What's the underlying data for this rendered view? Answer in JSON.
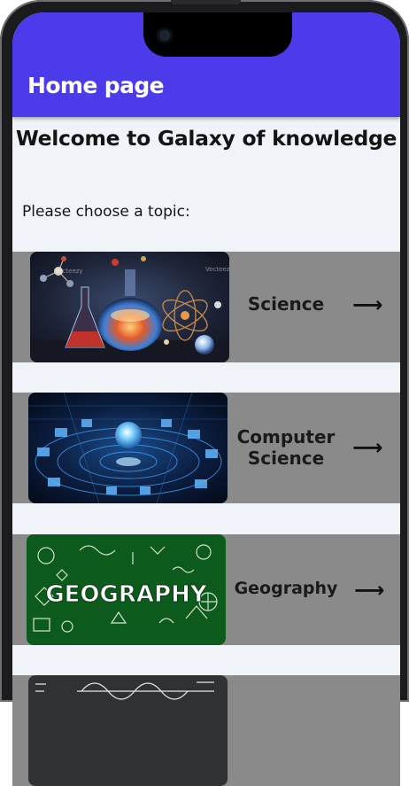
{
  "app_bar": {
    "title": "Home page"
  },
  "welcome": "Welcome to Galaxy of knowledge",
  "prompt": "Please choose a topic:",
  "topics": [
    {
      "label": "Science",
      "arrow": "⟶",
      "image": "science-lab-image"
    },
    {
      "label": "Computer Science",
      "arrow": "⟶",
      "image": "network-globe-image"
    },
    {
      "label": "Geography",
      "arrow": "⟶",
      "image": "geography-doodle-image"
    },
    {
      "label": "",
      "arrow": "",
      "image": "math-chalkboard-image"
    }
  ],
  "images": {
    "science": {
      "watermark": "Vecteezy"
    },
    "geography": {
      "word": "GEOGRAPHY"
    }
  },
  "colors": {
    "app_bar": "#4b3bea",
    "background": "#f0f4f9",
    "card": "#8a8a8a"
  }
}
